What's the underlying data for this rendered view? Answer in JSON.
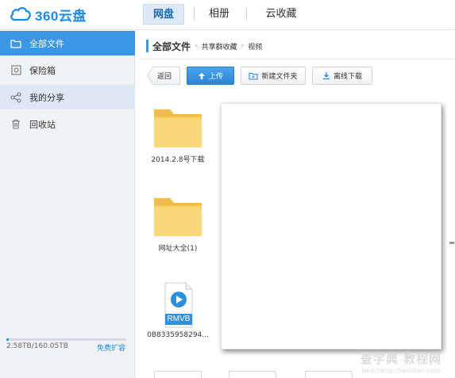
{
  "app": {
    "logo_text": "360云盘",
    "brand_color": "#1f8bdf"
  },
  "nav": {
    "tabs": [
      {
        "label": "网盘",
        "active": true
      },
      {
        "label": "相册",
        "active": false
      },
      {
        "label": "云收藏",
        "active": false
      }
    ]
  },
  "sidebar": {
    "items": [
      {
        "label": "全部文件",
        "icon": "folder-icon",
        "state": "active"
      },
      {
        "label": "保险箱",
        "icon": "safe-icon",
        "state": "normal"
      },
      {
        "label": "我的分享",
        "icon": "share-icon",
        "state": "hover"
      },
      {
        "label": "回收站",
        "icon": "trash-icon",
        "state": "normal"
      }
    ],
    "quota_text": "2.58TB/160.05TB",
    "quota_link": "免费扩容",
    "quota_used_fraction": 0.02
  },
  "breadcrumb": {
    "root": "全部文件",
    "items": [
      "共享群收藏",
      "视频"
    ]
  },
  "toolbar": {
    "back_label": "返回",
    "upload_label": "上传",
    "new_folder_label": "新建文件夹",
    "offline_download_label": "离线下载"
  },
  "files": [
    {
      "name": "2014.2.8号下载",
      "type": "folder"
    },
    {
      "name": "网址大全(1)",
      "type": "folder"
    },
    {
      "name": "0B8335958294...",
      "type": "rmvb",
      "badge": "RMVB"
    }
  ],
  "watermark": {
    "main": "查字典 教程网",
    "sub": "jiaocheng.chazidian.com"
  },
  "colors": {
    "accent": "#3b97e3",
    "folder": "#f7cf6b"
  }
}
